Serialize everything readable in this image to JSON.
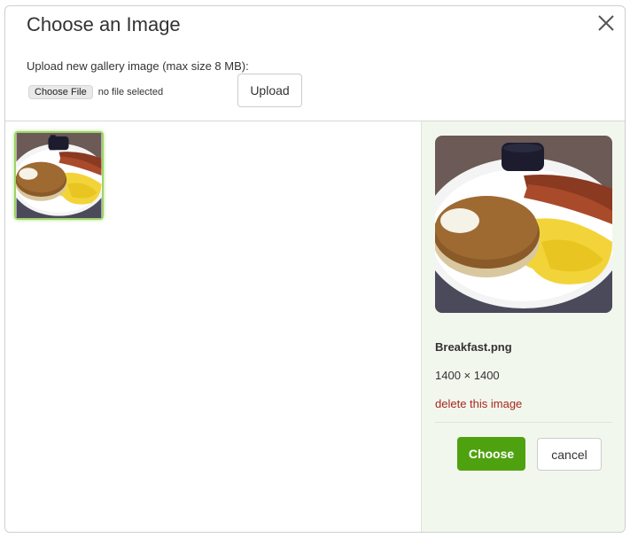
{
  "dialog": {
    "title": "Choose an Image",
    "close_icon": "close-icon"
  },
  "upload": {
    "label": "Upload new gallery image (max size 8 MB):",
    "file_button_label": "Choose File",
    "file_status": "no file selected",
    "upload_button_label": "Upload"
  },
  "gallery": {
    "items": [
      {
        "image": "breakfast-thumbnail",
        "selected": true
      }
    ]
  },
  "details": {
    "filename": "Breakfast.png",
    "dimensions": "1400 × 1400",
    "delete_label": "delete this image",
    "choose_label": "Choose",
    "cancel_label": "cancel"
  },
  "colors": {
    "accent_green": "#4fa20f",
    "selection_border": "#9ed36a",
    "side_panel_bg": "#f2f7ee",
    "delete_red": "#a8261b"
  }
}
